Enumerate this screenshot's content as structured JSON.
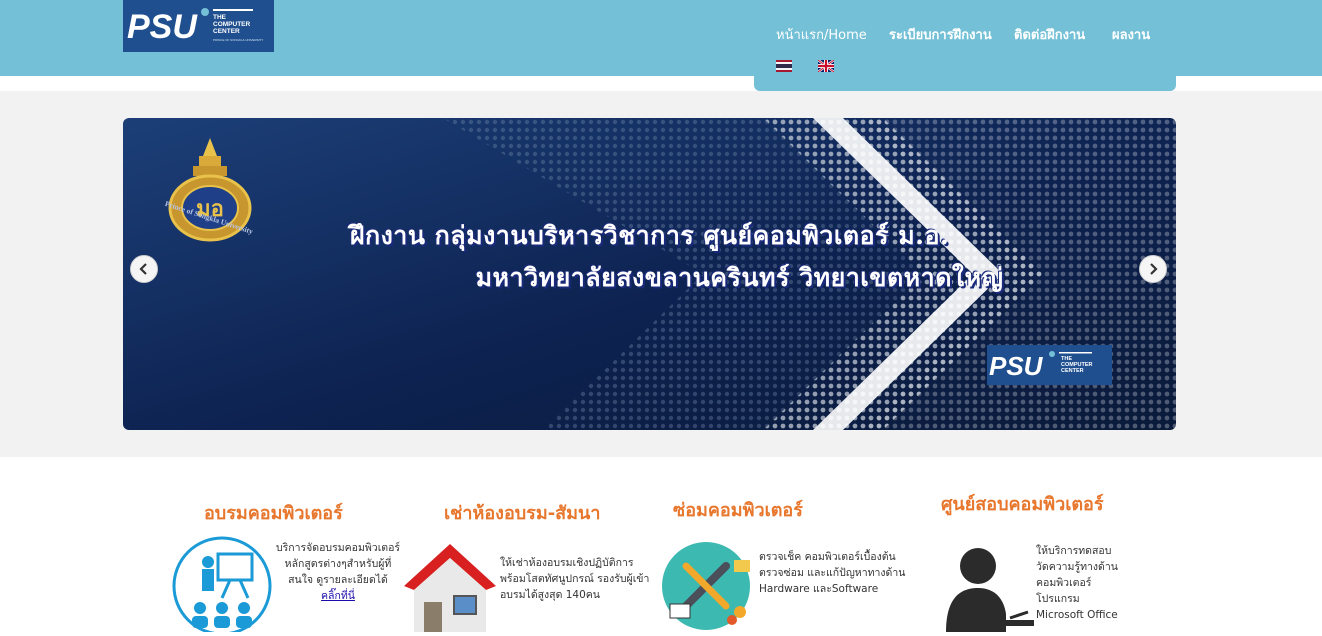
{
  "header": {
    "logo": {
      "mark": "PSU",
      "line1": "THE",
      "line2": "COMPUTER",
      "line3": "CENTER",
      "sub": "PRINCE OF SONGKLA UNIVERSITY"
    },
    "nav": [
      {
        "label": "หน้าแรก/Home"
      },
      {
        "label": "ระเบียบการฝึกงาน"
      },
      {
        "label": "ติดต่อฝึกงาน"
      },
      {
        "label": "ผลงาน"
      }
    ],
    "languages": [
      {
        "icon": "thai-flag-icon",
        "name": "Thai"
      },
      {
        "icon": "uk-flag-icon",
        "name": "English"
      }
    ]
  },
  "slider": {
    "line1": "ฝึกงาน กลุ่มงานบริหารวิชาการ ศูนย์คอมพิวเตอร์ ม.อ.",
    "line2": "มหาวิทยาลัยสงขลานครินทร์  วิทยาเขตหาดใหญ่",
    "seal_text": "Prince of Songkla University",
    "logo": {
      "mark": "PSU",
      "line1": "THE",
      "line2": "COMPUTER",
      "line3": "CENTER"
    },
    "prev_icon": "chevron-left-icon",
    "next_icon": "chevron-right-icon"
  },
  "services": [
    {
      "title": "อบรมคอมพิวเตอร์",
      "icon": "training-presentation-icon",
      "desc": [
        "บริการจัดอบรมคอมพิวเตอร์",
        "หลักสูตรต่างๆสำหรับผู้ที่",
        "สนใจ ดูรายละเอียดได้"
      ],
      "link": "คลิ๊กที่นี่"
    },
    {
      "title": "เช่าห้องอบรม-สัมนา",
      "icon": "house-icon",
      "desc": [
        "ให้เช่าห้องอบรมเชิงปฏิบัติการ",
        "พร้อมโสตทัศนูปกรณ์ รองรับผู้เข้า",
        "อบรมได้สูงสุด 140คน"
      ]
    },
    {
      "title": "ซ่อมคอมพิวเตอร์",
      "icon": "repair-tools-icon",
      "desc": [
        "ตรวจเช็ค คอมพิวเตอร์เบื้องต้น",
        "ตรวจซ่อม และแก้ปัญหาทางด้าน",
        "Hardware และSoftware"
      ]
    },
    {
      "title": "ศูนย์สอบคอมพิวเตอร์",
      "icon": "exam-person-icon",
      "desc": [
        "ให้บริการทดสอบ",
        "วัดความรู้ทางด้าน",
        "คอมพิวเตอร์",
        "โปรแกรม",
        "Microsoft Office"
      ]
    }
  ],
  "colors": {
    "header": "#74c0d6",
    "accent": "#e8772e",
    "slider_bg": "#0f2347",
    "logo_bg": "#1f4f8f"
  }
}
